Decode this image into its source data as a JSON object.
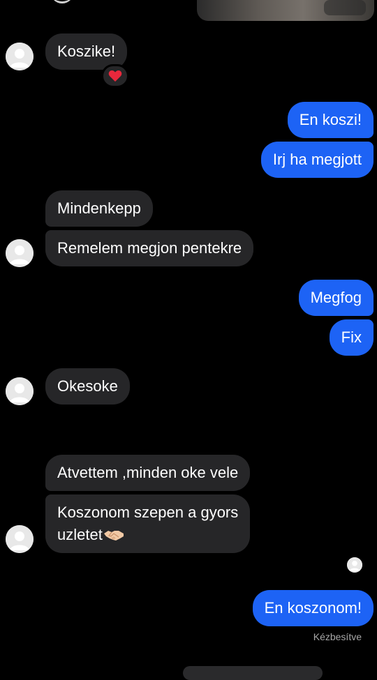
{
  "colors": {
    "background": "#000000",
    "incoming_bubble": "#262628",
    "outgoing_bubble": "#1d63f5",
    "status_text": "#a8a8a8"
  },
  "messages": {
    "m1": "Koszike!",
    "m2": "En koszi!",
    "m3": "Irj ha megjott",
    "m4": "Mindenkepp",
    "m5": "Remelem megjon pentekre",
    "m6": "Megfog",
    "m7": "Fix",
    "m8": "Okesoke",
    "m9": "Atvettem ,minden oke vele",
    "m10_line1": "Koszonom szepen a gyors",
    "m10_line2": "uzletet",
    "m11": "En koszonom!"
  },
  "reaction": {
    "icon": "heart-icon"
  },
  "status": {
    "delivered": "Kézbesítve"
  }
}
